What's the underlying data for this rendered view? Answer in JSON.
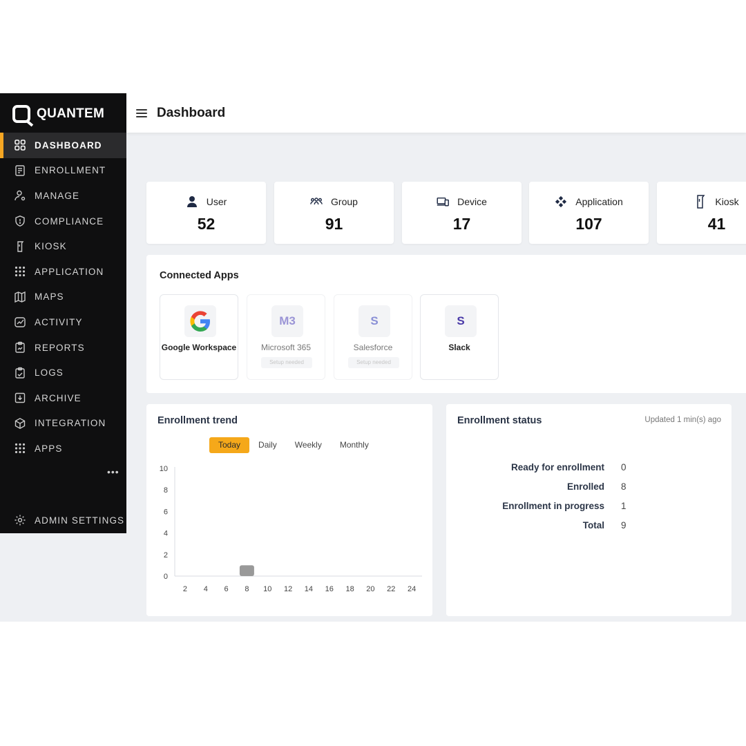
{
  "brand": {
    "name": "QUANTEM"
  },
  "sidebar": {
    "items": [
      {
        "label": "DASHBOARD",
        "icon": "grid-icon",
        "active": true
      },
      {
        "label": "ENROLLMENT",
        "icon": "form-icon",
        "active": false
      },
      {
        "label": "MANAGE",
        "icon": "user-gear-icon",
        "active": false
      },
      {
        "label": "COMPLIANCE",
        "icon": "shield-icon",
        "active": false
      },
      {
        "label": "KIOSK",
        "icon": "kiosk-icon",
        "active": false
      },
      {
        "label": "APPLICATION",
        "icon": "dots-grid-icon",
        "active": false
      },
      {
        "label": "MAPS",
        "icon": "map-icon",
        "active": false
      },
      {
        "label": "ACTIVITY",
        "icon": "activity-icon",
        "active": false
      },
      {
        "label": "REPORTS",
        "icon": "report-icon",
        "active": false
      },
      {
        "label": "LOGS",
        "icon": "logs-icon",
        "active": false
      },
      {
        "label": "ARCHIVE",
        "icon": "archive-icon",
        "active": false
      },
      {
        "label": "INTEGRATION",
        "icon": "cube-icon",
        "active": false
      },
      {
        "label": "APPS",
        "icon": "dots-grid-icon",
        "active": false
      }
    ],
    "more": "•••",
    "admin_settings": "ADMIN SETTINGS"
  },
  "header": {
    "title": "Dashboard"
  },
  "stats": [
    {
      "label": "User",
      "value": "52",
      "icon": "user-icon"
    },
    {
      "label": "Group",
      "value": "91",
      "icon": "group-icon"
    },
    {
      "label": "Device",
      "value": "17",
      "icon": "device-icon"
    },
    {
      "label": "Application",
      "value": "107",
      "icon": "application-icon"
    },
    {
      "label": "Kiosk",
      "value": "41",
      "icon": "kiosk-icon"
    }
  ],
  "connected_apps": {
    "title": "Connected Apps",
    "apps": [
      {
        "name": "Google Workspace",
        "logo": "G",
        "enabled": true
      },
      {
        "name": "Microsoft 365",
        "logo": "M3",
        "enabled": false,
        "setup": "Setup needed"
      },
      {
        "name": "Salesforce",
        "logo": "S",
        "enabled": false,
        "setup": "Setup needed"
      },
      {
        "name": "Slack",
        "logo": "S",
        "enabled": true
      }
    ]
  },
  "enrollment_trend": {
    "title": "Enrollment trend",
    "tabs": [
      "Today",
      "Daily",
      "Weekly",
      "Monthly"
    ],
    "active_tab": "Today"
  },
  "chart_data": {
    "type": "bar",
    "categories": [
      "2",
      "4",
      "6",
      "8",
      "10",
      "12",
      "14",
      "16",
      "18",
      "20",
      "22",
      "24"
    ],
    "values": [
      0,
      0,
      0,
      1,
      0,
      0,
      0,
      0,
      0,
      0,
      0,
      0
    ],
    "xlabel": "",
    "ylabel": "",
    "ylim": [
      0,
      10
    ],
    "yticks": [
      0,
      2,
      4,
      6,
      8,
      10
    ],
    "bar_color": "#999999",
    "grid": false
  },
  "enrollment_status": {
    "title": "Enrollment status",
    "updated": "Updated 1 min(s) ago",
    "rows": [
      {
        "label": "Ready for enrollment",
        "value": "0"
      },
      {
        "label": "Enrolled",
        "value": "8"
      },
      {
        "label": "Enrollment in progress",
        "value": "1"
      },
      {
        "label": "Total",
        "value": "9"
      }
    ]
  },
  "colors": {
    "accent": "#f5a623",
    "sidebar_bg": "#0f0f10",
    "page_bg": "#eef0f3",
    "slack_logo": "#4a3aa8",
    "ms_logo": "#9b95d6",
    "salesforce_logo": "#8a90d6"
  }
}
